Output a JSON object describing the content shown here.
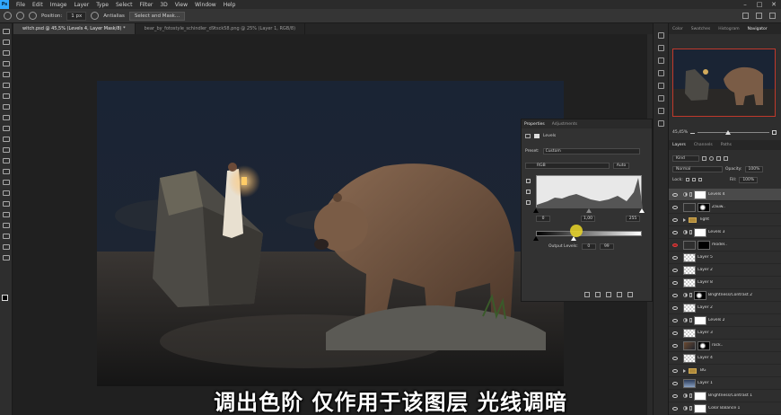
{
  "menubar": {
    "logo": "Ps",
    "items": [
      "File",
      "Edit",
      "Image",
      "Layer",
      "Type",
      "Select",
      "Filter",
      "3D",
      "View",
      "Window",
      "Help"
    ]
  },
  "optbar": {
    "position_label": "Position:",
    "position_value": "1 px",
    "antialias_label": "Antialias",
    "select_mask_button": "Select and Mask..."
  },
  "tabs": [
    {
      "label": "witch.psd @ 45,5% (Levels 4, Layer Mask/8) *",
      "active": true
    },
    {
      "label": "bear_by_fotostyle_schindler_d9tsck58.png @ 25% (Layer 1, RGB/8)",
      "active": false
    }
  ],
  "properties": {
    "tab_properties": "Properties",
    "tab_adjustments": "Adjustments",
    "title": "Levels",
    "preset_label": "Preset:",
    "preset_value": "Custom",
    "channel_value": "RGB",
    "auto_button": "Auto",
    "input_black": "0",
    "input_gamma": "1,00",
    "input_white": "255",
    "output_label": "Output Levels:",
    "output_black": "0",
    "output_white": "99",
    "colors": {
      "histogram_bg": "#e8e8e8",
      "cursor": "#ebd728"
    }
  },
  "right_panel": {
    "top_tabs": [
      "Color",
      "Swatches",
      "Histogram",
      "Navigator"
    ],
    "top_active": "Navigator",
    "zoom": "45,45%",
    "layer_tabs": [
      "Layers",
      "Channels",
      "Paths"
    ],
    "layer_active": "Layers",
    "kind_filter": "Kind",
    "blend_mode": "Normal",
    "opacity_label": "Opacity:",
    "opacity_value": "100%",
    "lock_label": "Lock:",
    "fill_label": "Fill:",
    "fill_value": "100%"
  },
  "layers": [
    {
      "name": "Levels 4",
      "type": "adj",
      "mask": "white",
      "selected": true
    },
    {
      "name": "Zauw..",
      "type": "pixel",
      "mask": "mask",
      "selected": false
    },
    {
      "name": "light",
      "type": "folder",
      "selected": false
    },
    {
      "name": "Levels 3",
      "type": "adj",
      "mask": "white",
      "selected": false
    },
    {
      "name": "model..",
      "type": "pixel",
      "mask": "black",
      "selected": false,
      "red_eye": true
    },
    {
      "name": "Layer 5",
      "type": "checker",
      "selected": false
    },
    {
      "name": "Layer 2",
      "type": "checker",
      "selected": false
    },
    {
      "name": "Layer 8",
      "type": "checker",
      "selected": false
    },
    {
      "name": "Brightness/Contrast 2",
      "type": "adj",
      "mask": "mask",
      "selected": false
    },
    {
      "name": "Layer 2",
      "type": "checker",
      "selected": false
    },
    {
      "name": "Levels 2",
      "type": "adj",
      "mask": "white",
      "selected": false
    },
    {
      "name": "Layer 3",
      "type": "checker",
      "selected": false
    },
    {
      "name": "rock..",
      "type": "photo",
      "mask": "mask",
      "selected": false
    },
    {
      "name": "Layer 4",
      "type": "checker",
      "selected": false
    },
    {
      "name": "BG",
      "type": "folder",
      "selected": false
    },
    {
      "name": "Layer 1",
      "type": "gradsky",
      "selected": false
    },
    {
      "name": "Brightness/Contrast 1",
      "type": "adj",
      "mask": "white",
      "selected": false
    },
    {
      "name": "Color Balance 1",
      "type": "adj",
      "mask": "white",
      "selected": false
    }
  ],
  "subtitle": "调出色阶 仅作用于该图层 光线调暗"
}
